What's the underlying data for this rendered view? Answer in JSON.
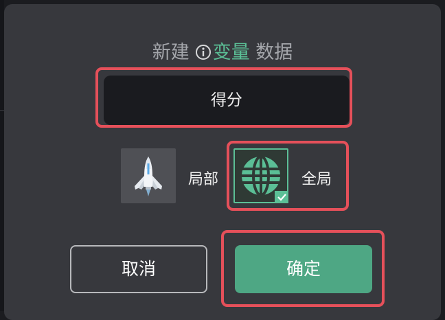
{
  "dialog": {
    "title_prefix": "新建",
    "title_term": "变量",
    "title_suffix": "数据"
  },
  "name_field": {
    "value": "得分"
  },
  "scope": {
    "local_label": "局部",
    "global_label": "全局",
    "selected": "全局"
  },
  "buttons": {
    "cancel": "取消",
    "confirm": "确定"
  },
  "colors": {
    "accent": "#5bbf96",
    "confirm_bg": "#4ea784",
    "highlight": "#e5505a",
    "dialog_bg": "#37383d"
  },
  "icons": {
    "info": "info-icon",
    "local": "rocket-icon",
    "global": "globe-icon",
    "selected_check": "check-icon"
  }
}
